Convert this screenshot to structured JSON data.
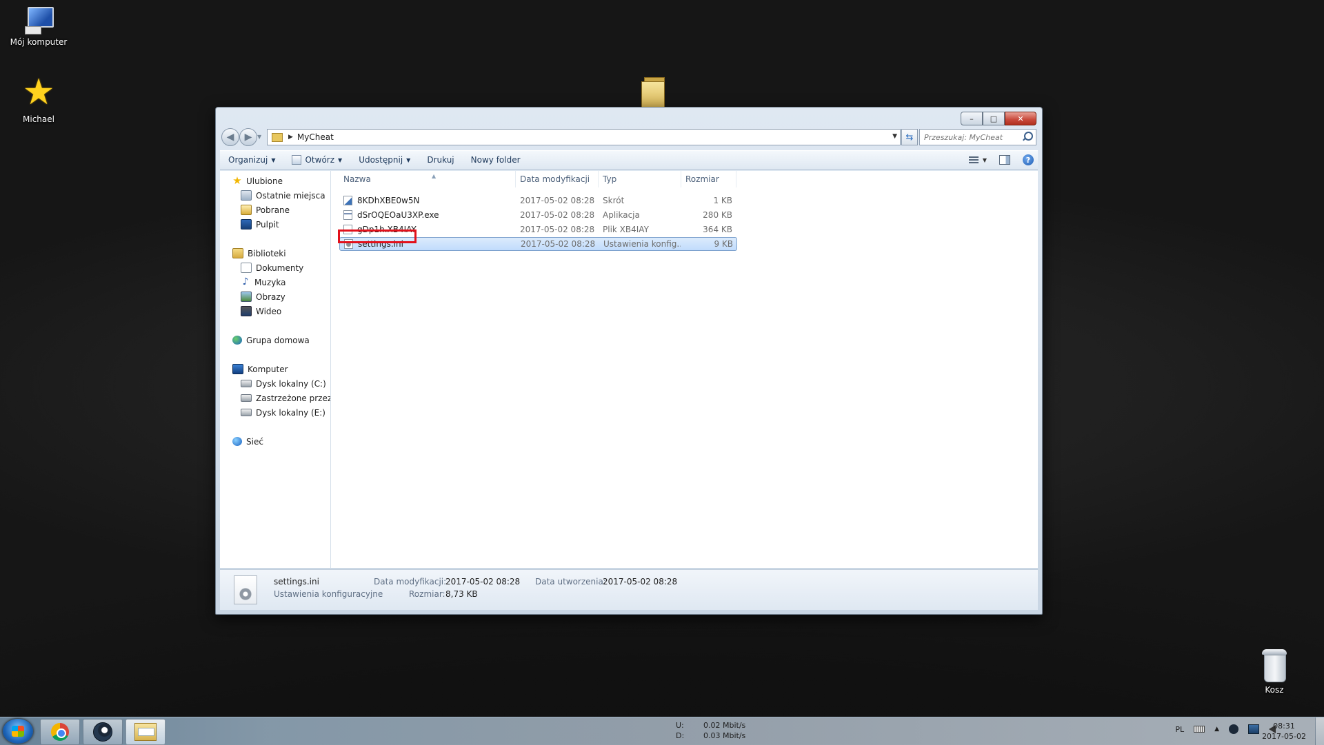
{
  "desktop": {
    "icons": [
      {
        "label": "Mój komputer",
        "icon": "computer-icon"
      },
      {
        "label": "Michael",
        "icon": "star-icon"
      },
      {
        "label": "Kosz",
        "icon": "recycle-bin-icon"
      }
    ]
  },
  "window": {
    "caption": {
      "minimize": "–",
      "maximize": "□",
      "close": "✕"
    },
    "address": {
      "folder": "MyCheat"
    },
    "search": {
      "placeholder": "Przeszukaj: MyCheat"
    },
    "commands": {
      "organize": "Organizuj",
      "open": "Otwórz",
      "share": "Udostępnij",
      "print": "Drukuj",
      "new_folder": "Nowy folder"
    },
    "nav_pane": {
      "favorites": {
        "label": "Ulubione",
        "items": [
          "Ostatnie miejsca",
          "Pobrane",
          "Pulpit"
        ]
      },
      "libraries": {
        "label": "Biblioteki",
        "items": [
          "Dokumenty",
          "Muzyka",
          "Obrazy",
          "Wideo"
        ]
      },
      "homegroup": {
        "label": "Grupa domowa"
      },
      "computer": {
        "label": "Komputer",
        "items": [
          "Dysk lokalny (C:)",
          "Zastrzeżone przez sy",
          "Dysk lokalny (E:)"
        ]
      },
      "network": {
        "label": "Sieć"
      }
    },
    "columns": {
      "name": "Nazwa",
      "date": "Data modyfikacji",
      "type": "Typ",
      "size": "Rozmiar"
    },
    "files": [
      {
        "name": "8KDhXBE0w5N",
        "date": "2017-05-02 08:28",
        "type": "Skrót",
        "size": "1 KB",
        "icon": "shortcut-icon"
      },
      {
        "name": "dSrOQEOaU3XP.exe",
        "date": "2017-05-02 08:28",
        "type": "Aplikacja",
        "size": "280 KB",
        "icon": "exe-icon"
      },
      {
        "name": "gDp1h.XB4IAY",
        "date": "2017-05-02 08:28",
        "type": "Plik XB4IAY",
        "size": "364 KB",
        "icon": "file-icon"
      },
      {
        "name": "settings.ini",
        "date": "2017-05-02 08:28",
        "type": "Ustawienia konfig...",
        "size": "9 KB",
        "icon": "ini-file-icon",
        "selected": true
      }
    ],
    "details": {
      "name": "settings.ini",
      "type": "Ustawienia konfiguracyjne",
      "modified_label": "Data modyfikacji:",
      "modified_value": "2017-05-02 08:28",
      "created_label": "Data utworzenia:",
      "created_value": "2017-05-02 08:28",
      "size_label": "Rozmiar:",
      "size_value": "8,73 KB"
    }
  },
  "taskbar": {
    "net": {
      "up_label": "U:",
      "up_value": "0.02 Mbit/s",
      "down_label": "D:",
      "down_value": "0.03 Mbit/s"
    },
    "tray": {
      "language": "PL"
    },
    "clock": {
      "time": "08:31",
      "date": "2017-05-02"
    }
  },
  "colors": {
    "highlight_box": "#e2101b",
    "selection": "#c1dcfc",
    "accent": "#1e395b"
  }
}
